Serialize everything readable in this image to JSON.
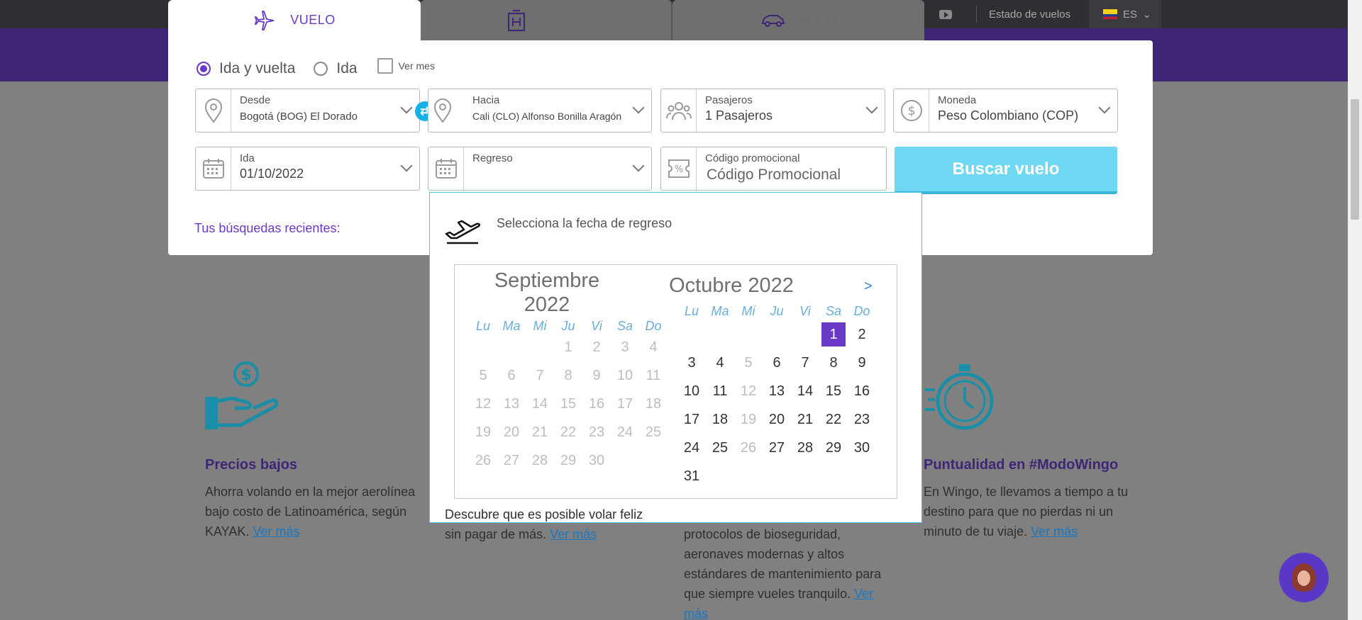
{
  "header": {
    "status_link": "Estado de vuelos",
    "language": "ES"
  },
  "tabs": [
    {
      "label": "VUELO"
    },
    {
      "label": "HOTEL"
    },
    {
      "label": "AUTO"
    }
  ],
  "trip_type": {
    "round_trip": "Ida y vuelta",
    "one_way": "Ida",
    "see_month": "Ver mes"
  },
  "fields": {
    "from": {
      "label": "Desde",
      "value": "Bogotá (BOG) El Dorado"
    },
    "to": {
      "label": "Hacia",
      "value": "Cali (CLO) Alfonso Bonilla Aragón"
    },
    "passengers": {
      "label": "Pasajeros",
      "value": "1 Pasajeros"
    },
    "currency": {
      "label": "Moneda",
      "value": "Peso Colombiano (COP)"
    },
    "depart": {
      "label": "Ida",
      "value": "01/10/2022"
    },
    "return": {
      "label": "Regreso",
      "value": ""
    },
    "promo": {
      "label": "Código promocional",
      "placeholder": "Código Promocional"
    }
  },
  "search_button": "Buscar vuelo",
  "recent_searches": "Tus búsquedas recientes:",
  "calendar": {
    "heading": "Selecciona la fecha de regreso",
    "next_label": ">",
    "weekdays": [
      "Lu",
      "Ma",
      "Mi",
      "Ju",
      "Vi",
      "Sa",
      "Do"
    ],
    "month1_line1": "Septiembre",
    "month1_line2": "2022",
    "month2": "Octubre 2022",
    "selected_day": "1"
  },
  "features": [
    {
      "title": "Precios bajos",
      "text": "Ahorra volando en la mejor aerolínea bajo costo de Latinoamérica, según KAYAK.",
      "link": "Ver más"
    },
    {
      "text": "Descubre que es posible volar feliz sin pagar de más.",
      "link": "Ver más"
    },
    {
      "text": "protocolos de bioseguridad, aeronaves modernas y altos estándares de mantenimiento para que siempre vueles tranquilo.",
      "link": "Ver más"
    },
    {
      "title": "Puntualidad en #ModoWingo",
      "text": "En Wingo, te llevamos a tiempo a tu destino para que no pierdas ni un minuto de tu viaje.",
      "link": "Ver más"
    }
  ],
  "colors": {
    "brand_purple": "#6a39c6",
    "accent_cyan": "#6fd8f3"
  }
}
